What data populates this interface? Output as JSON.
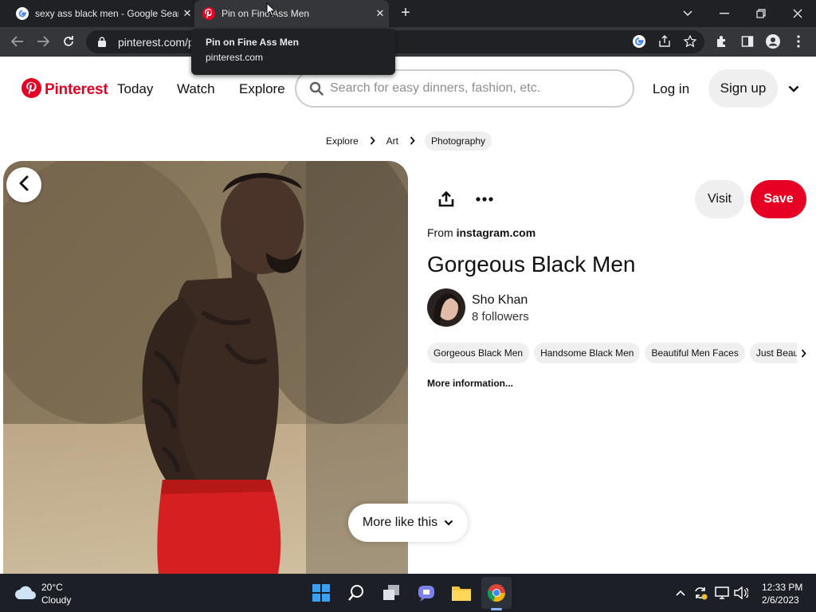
{
  "browser": {
    "tabs": [
      {
        "title": "sexy ass black men - Google Sear",
        "favicon": "google-icon",
        "active": false
      },
      {
        "title": "Pin on Fine Ass Men",
        "favicon": "pinterest-icon",
        "active": true
      }
    ],
    "new_tab_label": "+",
    "url": "pinterest.com/p",
    "tooltip": {
      "title": "Pin on Fine Ass Men",
      "domain": "pinterest.com"
    }
  },
  "header": {
    "logo_text": "Pinterest",
    "nav": [
      "Today",
      "Watch",
      "Explore"
    ],
    "search_placeholder": "Search for easy dinners, fashion, etc.",
    "login_label": "Log in",
    "signup_label": "Sign up"
  },
  "breadcrumb": [
    "Explore",
    "Art",
    "Photography"
  ],
  "pin": {
    "visit_label": "Visit",
    "save_label": "Save",
    "source_prefix": "From ",
    "source_domain": "instagram.com",
    "title": "Gorgeous Black Men",
    "creator_name": "Sho Khan",
    "creator_followers": "8 followers",
    "tags": [
      "Gorgeous Black Men",
      "Handsome Black Men",
      "Beautiful Men Faces",
      "Just Beau"
    ],
    "more_info_label": "More information...",
    "more_like_label": "More like this"
  },
  "taskbar": {
    "weather_temp": "20°C",
    "weather_desc": "Cloudy",
    "time": "12:33 PM",
    "date": "2/6/2023"
  },
  "colors": {
    "pinterest_red": "#e60023",
    "chrome_dark": "#202124",
    "chrome_toolbar": "#35363a",
    "taskbar": "#1c1f26"
  }
}
